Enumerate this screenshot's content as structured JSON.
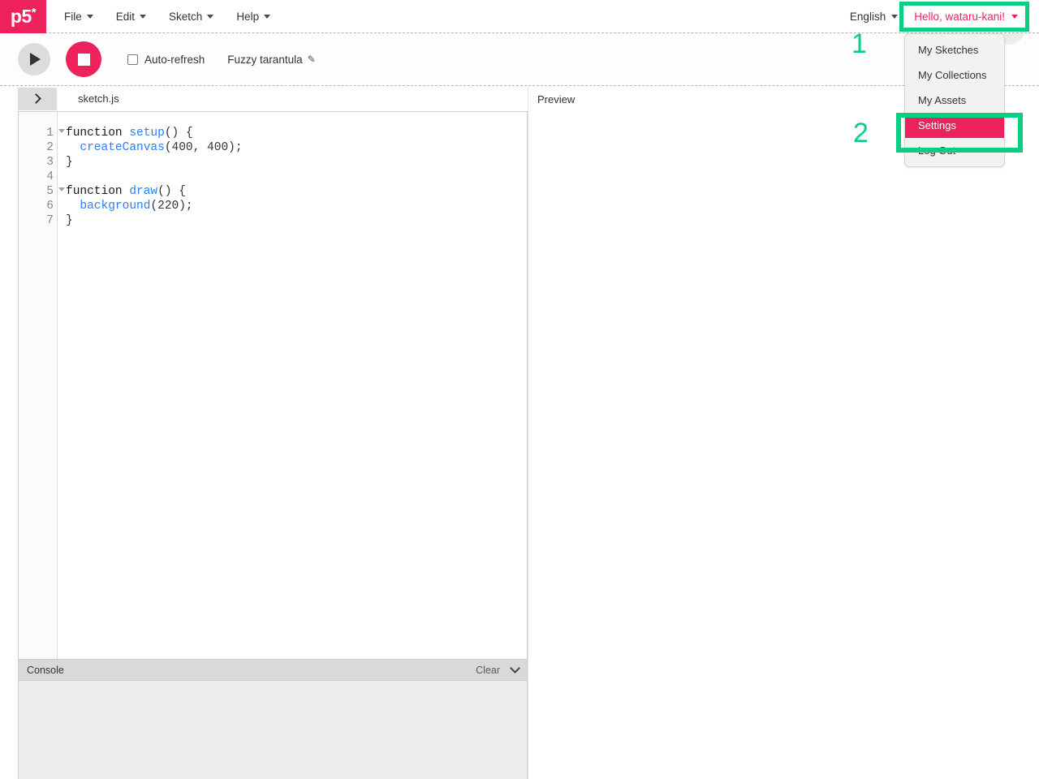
{
  "app": {
    "logo_text": "p5",
    "logo_star": "*",
    "brand_pink": "#ED225D",
    "annotation_green": "#0ACF83"
  },
  "navbar": {
    "menus": [
      {
        "label": "File"
      },
      {
        "label": "Edit"
      },
      {
        "label": "Sketch"
      },
      {
        "label": "Help"
      }
    ],
    "language": "English",
    "user_greeting": "Hello, wataru-kani!"
  },
  "user_dropdown": {
    "items": [
      {
        "label": "My Sketches",
        "active": false
      },
      {
        "label": "My Collections",
        "active": false
      },
      {
        "label": "My Assets",
        "active": false
      },
      {
        "label": "Settings",
        "active": true
      },
      {
        "label": "Log Out",
        "active": false
      }
    ]
  },
  "annotations": {
    "step_one": "1",
    "step_two": "2"
  },
  "toolbar": {
    "play_icon": "play-icon",
    "stop_icon": "stop-icon",
    "auto_refresh_label": "Auto-refresh",
    "auto_refresh_checked": false,
    "sketch_name": "Fuzzy tarantula",
    "edit_icon": "✎",
    "gear_icon": "gear-icon"
  },
  "editor": {
    "sidebar_toggle_icon": "chevron-right-icon",
    "file_tab": "sketch.js",
    "line_numbers": [
      "1",
      "2",
      "3",
      "4",
      "5",
      "6",
      "7"
    ],
    "fold_lines": [
      1,
      5
    ],
    "code_lines": [
      {
        "n": 1,
        "parts": [
          {
            "t": "function ",
            "c": "tok-fn"
          },
          {
            "t": "setup",
            "c": "tok-name"
          },
          {
            "t": "() {",
            "c": "tok-p"
          }
        ]
      },
      {
        "n": 2,
        "parts": [
          {
            "t": "  ",
            "c": "tok-p"
          },
          {
            "t": "createCanvas",
            "c": "tok-name"
          },
          {
            "t": "(400, 400);",
            "c": "tok-p"
          }
        ]
      },
      {
        "n": 3,
        "parts": [
          {
            "t": "}",
            "c": "tok-p"
          }
        ]
      },
      {
        "n": 4,
        "parts": [
          {
            "t": "",
            "c": "tok-p"
          }
        ]
      },
      {
        "n": 5,
        "parts": [
          {
            "t": "function ",
            "c": "tok-fn"
          },
          {
            "t": "draw",
            "c": "tok-name"
          },
          {
            "t": "() {",
            "c": "tok-p"
          }
        ]
      },
      {
        "n": 6,
        "parts": [
          {
            "t": "  ",
            "c": "tok-p"
          },
          {
            "t": "background",
            "c": "tok-name"
          },
          {
            "t": "(220);",
            "c": "tok-p"
          }
        ]
      },
      {
        "n": 7,
        "parts": [
          {
            "t": "}",
            "c": "tok-p"
          }
        ]
      }
    ]
  },
  "console": {
    "title": "Console",
    "clear_label": "Clear",
    "collapse_icon": "chevron-down-icon",
    "messages": []
  },
  "preview": {
    "label": "Preview"
  }
}
